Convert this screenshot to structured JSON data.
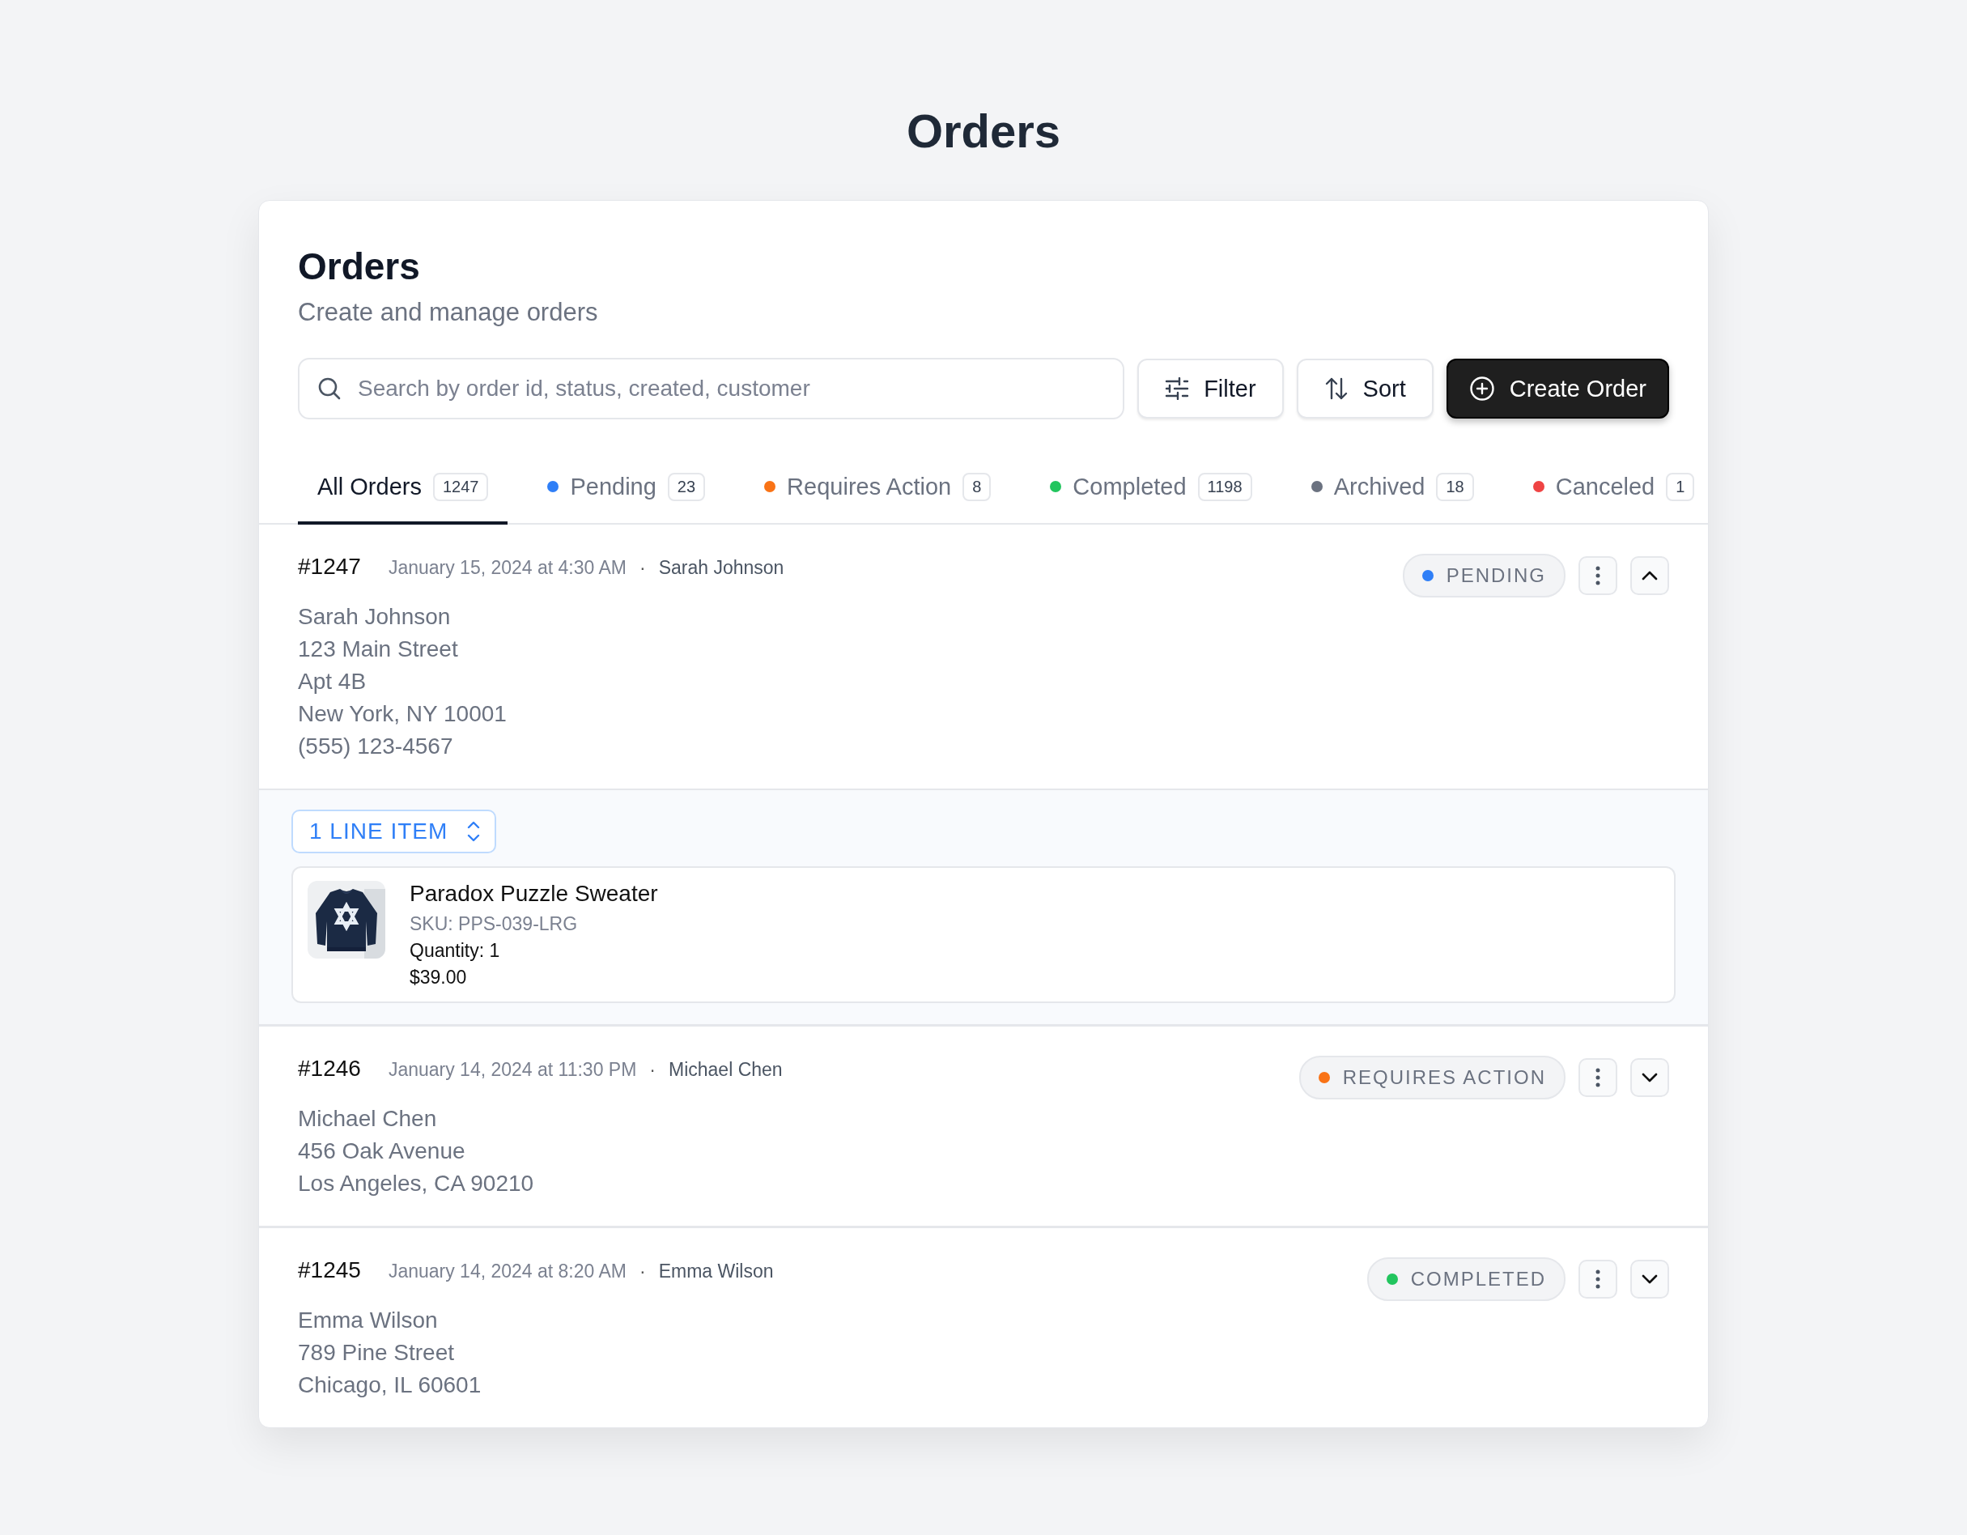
{
  "page_title": "Orders",
  "card": {
    "title": "Orders",
    "subtitle": "Create and manage orders"
  },
  "search": {
    "placeholder": "Search by order id, status, created, customer"
  },
  "buttons": [
    {
      "kind": "filter",
      "label": "Filter"
    },
    {
      "kind": "sort",
      "label": "Sort"
    },
    {
      "kind": "create",
      "label": "Create Order"
    }
  ],
  "tabs": [
    {
      "label": "All Orders",
      "count": "1247",
      "selected": true
    },
    {
      "label": "Pending",
      "count": "23",
      "selected": false,
      "color": "#2f7ff7"
    },
    {
      "label": "Requires Action",
      "count": "8",
      "selected": false,
      "color": "#f97316"
    },
    {
      "label": "Completed",
      "count": "1198",
      "selected": false,
      "color": "#22c55e"
    },
    {
      "label": "Archived",
      "count": "18",
      "selected": false,
      "color": "#6b7280"
    },
    {
      "label": "Canceled",
      "count": "1",
      "selected": false,
      "color": "#ef4444"
    }
  ],
  "orders": [
    {
      "id": "#1247",
      "date": "January 15, 2024 at 4:30 AM",
      "separator": "·",
      "customer": "Sarah Johnson",
      "status": {
        "label": "PENDING",
        "color": "#2f7ff7"
      },
      "expanded": true,
      "address": [
        "Sarah Johnson",
        "123 Main Street",
        "Apt 4B",
        "New York, NY 10001",
        "(555) 123-4567"
      ],
      "line_items_toggle": "1 LINE ITEM",
      "line_items": [
        {
          "kind": "picture",
          "name": "Paradox Puzzle Sweater",
          "sku": "SKU: PPS-039-LRG",
          "quantity": "Quantity: 1",
          "price": "$39.00"
        }
      ]
    },
    {
      "id": "#1246",
      "date": "January 14, 2024 at 11:30 PM",
      "separator": "·",
      "customer": "Michael Chen",
      "status": {
        "label": "REQUIRES ACTION",
        "color": "#f97316"
      },
      "expanded": false,
      "address": [
        "Michael Chen",
        "456 Oak Avenue",
        "Los Angeles, CA 90210"
      ]
    },
    {
      "id": "#1245",
      "date": "January 14, 2024 at 8:20 AM",
      "separator": "·",
      "customer": "Emma Wilson",
      "status": {
        "label": "COMPLETED",
        "color": "#22c55e"
      },
      "expanded": false,
      "address": [
        "Emma Wilson",
        "789 Pine Street",
        "Chicago, IL 60601"
      ]
    }
  ]
}
